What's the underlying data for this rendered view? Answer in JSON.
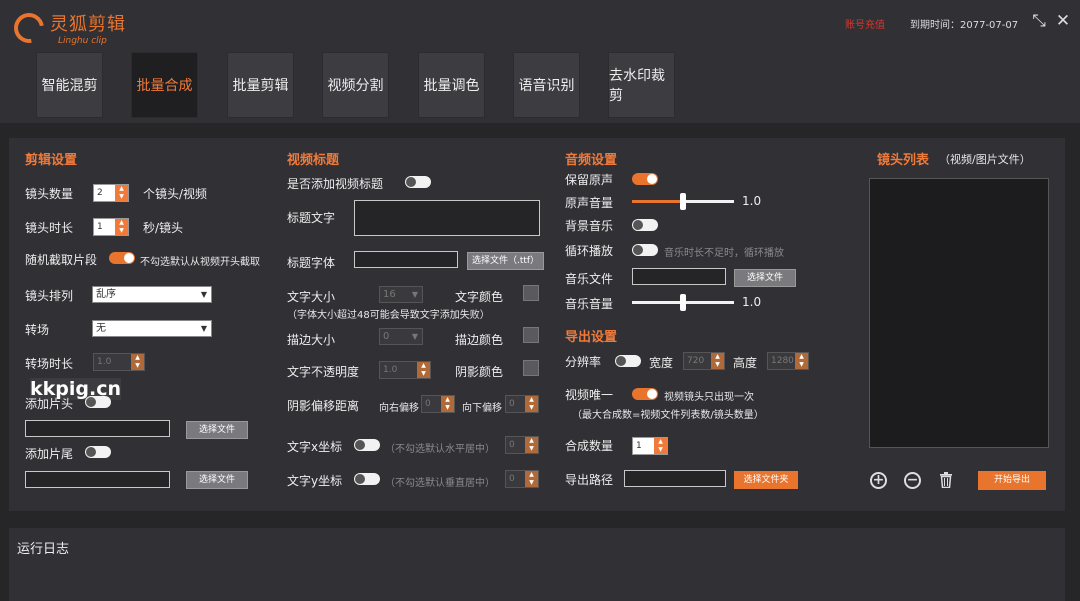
{
  "app": {
    "logo_cn": "灵狐剪辑",
    "logo_en": "Linghu clip",
    "account_status": "账号充值",
    "expire_text": "到期时间：2077-07-07"
  },
  "tabs": [
    {
      "label": "智能混剪",
      "active": false
    },
    {
      "label": "批量合成",
      "active": true
    },
    {
      "label": "批量剪辑",
      "active": false
    },
    {
      "label": "视频分割",
      "active": false
    },
    {
      "label": "批量调色",
      "active": false
    },
    {
      "label": "语音识别",
      "active": false
    },
    {
      "label": "去水印裁剪",
      "active": false
    }
  ],
  "edit": {
    "title": "剪辑设置",
    "shot_count_label": "镜头数量",
    "shot_count_value": "2",
    "shot_count_unit": "个镜头/视频",
    "shot_len_label": "镜头时长",
    "shot_len_value": "1",
    "shot_len_unit": "秒/镜头",
    "random_label": "随机截取片段",
    "random_hint": "不勾选默认从视频开头截取",
    "order_label": "镜头排列",
    "order_value": "乱序",
    "transition_label": "转场",
    "transition_value": "无",
    "transition_len_label": "转场时长",
    "transition_len_value": "1.0",
    "intro_label": "添加片头",
    "outro_label": "添加片尾",
    "choose_file": "选择文件"
  },
  "video_title": {
    "title": "视频标题",
    "add_label": "是否添加视频标题",
    "text_label": "标题文字",
    "font_label": "标题字体",
    "font_button": "选择文件（.ttf）",
    "size_label": "文字大小",
    "size_value": "16",
    "color_label": "文字颜色",
    "size_note": "（字体大小超过48可能会导致文字添加失败）",
    "stroke_label": "描边大小",
    "stroke_value": "0",
    "stroke_color_label": "描边颜色",
    "opacity_label": "文字不透明度",
    "opacity_value": "1.0",
    "shadow_color_label": "阴影颜色",
    "shadow_offset_label": "阴影偏移距离",
    "right_offset_label": "向右偏移",
    "right_offset_value": "0",
    "down_offset_label": "向下偏移",
    "down_offset_value": "0",
    "x_label": "文字x坐标",
    "x_hint": "（不勾选默认水平居中）",
    "x_value": "0",
    "y_label": "文字y坐标",
    "y_hint": "（不勾选默认垂直居中）",
    "y_value": "0"
  },
  "audio": {
    "title": "音频设置",
    "keep_label": "保留原声",
    "orig_vol_label": "原声音量",
    "orig_vol_value": "1.0",
    "orig_vol_fraction": 0.5,
    "bgm_label": "背景音乐",
    "loop_label": "循环播放",
    "loop_hint": "音乐时长不足时，循环播放",
    "music_file_label": "音乐文件",
    "choose_file": "选择文件",
    "music_vol_label": "音乐音量",
    "music_vol_value": "1.0",
    "music_vol_fraction": 0.5
  },
  "export": {
    "title": "导出设置",
    "resolution_label": "分辨率",
    "width_label": "宽度",
    "width_value": "720",
    "height_label": "高度",
    "height_value": "1280",
    "unique_label": "视频唯一",
    "unique_hint": "视频镜头只出现一次",
    "unique_note": "（最大合成数=视频文件列表数/镜头数量）",
    "count_label": "合成数量",
    "count_value": "1",
    "path_label": "导出路径",
    "path_button": "选择文件夹"
  },
  "shot_list": {
    "title": "镜头列表",
    "subtitle": "（视频/图片文件）",
    "start_button": "开始导出"
  },
  "log": {
    "title": "运行日志"
  },
  "watermark": "kkpig.cn",
  "colors": {
    "accent": "#e8742e",
    "account": "#e0342a",
    "panel": "#303035"
  }
}
